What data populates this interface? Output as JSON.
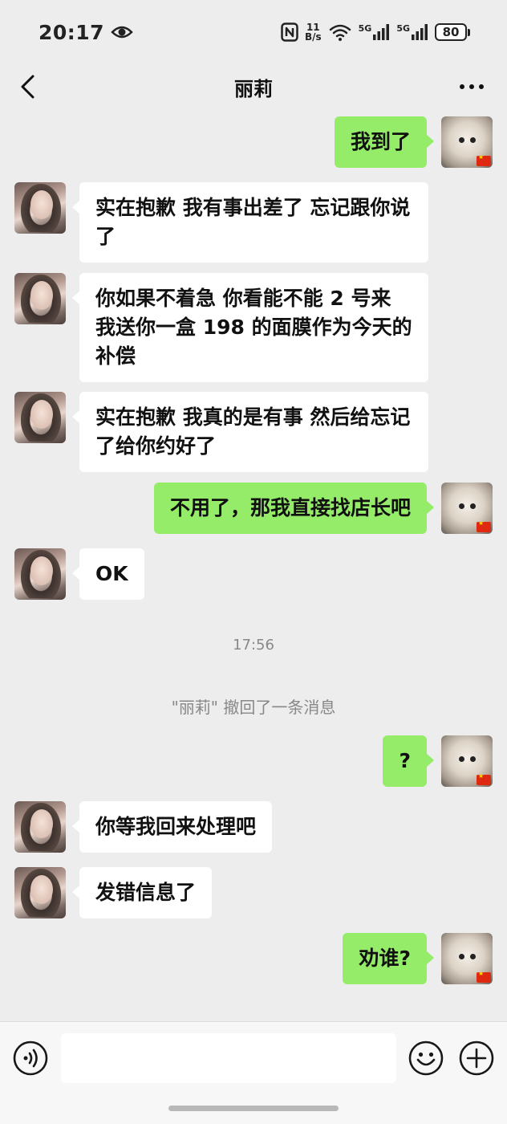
{
  "status_bar": {
    "time": "20:17",
    "net_speed_value": "11",
    "net_speed_unit": "B/s",
    "signal1_label": "5G",
    "signal2_label": "5G",
    "battery_level": "80"
  },
  "header": {
    "title": "丽莉"
  },
  "messages": [
    {
      "side": "out",
      "text": "我到了"
    },
    {
      "side": "in",
      "text": "实在抱歉 我有事出差了 忘记跟你说了"
    },
    {
      "side": "in",
      "text": "你如果不着急 你看能不能 2 号来 我送你一盒 198 的面膜作为今天的补偿"
    },
    {
      "side": "in",
      "text": "实在抱歉 我真的是有事 然后给忘记了给你约好了"
    },
    {
      "side": "out",
      "text": "不用了，那我直接找店长吧"
    },
    {
      "side": "in",
      "text": "OK"
    },
    {
      "side": "out",
      "text": "?"
    },
    {
      "side": "in",
      "text": "你等我回来处理吧"
    },
    {
      "side": "in",
      "text": "发错信息了"
    },
    {
      "side": "out",
      "text": "劝谁?"
    }
  ],
  "time_divider": "17:56",
  "system_note": "\"丽莉\" 撤回了一条消息",
  "input_bar": {
    "placeholder": ""
  },
  "colors": {
    "background": "#ededed",
    "outgoing_bubble": "#95ec69",
    "incoming_bubble": "#ffffff"
  },
  "icons": [
    "eye-icon",
    "nfc-icon",
    "wifi-icon",
    "signal-icon",
    "battery-icon",
    "back-icon",
    "more-icon",
    "voice-icon",
    "emoji-icon",
    "plus-icon"
  ]
}
